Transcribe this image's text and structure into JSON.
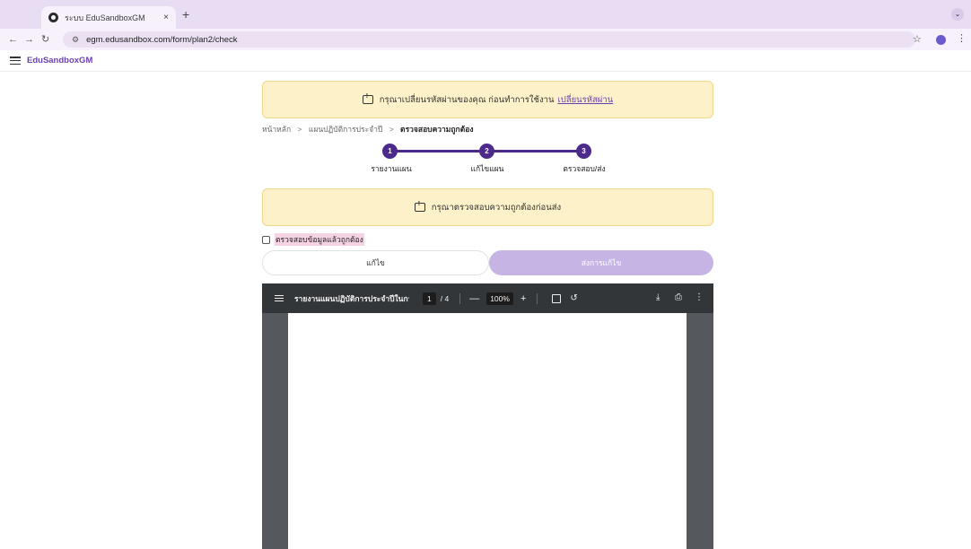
{
  "browser": {
    "tab_title": "ระบบ EduSandboxGM",
    "tab_close": "×",
    "new_tab": "+",
    "url": "egm.edusandbox.com/form/plan2/check"
  },
  "app": {
    "brand": "EduSandboxGM"
  },
  "notice_password": {
    "text": "กรุณาเปลี่ยนรหัสผ่านของคุณ ก่อนทำการใช้งาน",
    "link": "เปลี่ยนรหัสผ่าน"
  },
  "breadcrumb": {
    "items": [
      "หน้าหลัก",
      "แผนปฏิบัติการประจำปี",
      "ตรวจสอบความถูกต้อง"
    ],
    "separator": ">"
  },
  "stepper": {
    "steps": [
      {
        "number": "1",
        "label": "รายงานแผน"
      },
      {
        "number": "2",
        "label": "แก้ไขแผน"
      },
      {
        "number": "3",
        "label": "ตรวจสอบ/ส่ง"
      }
    ]
  },
  "notice_verify": {
    "text": "กรุณาตรวจสอบความถูกต้องก่อนส่ง"
  },
  "confirm": {
    "label": "ตรวจสอบข้อมูลแล้วถูกต้อง",
    "checked": false
  },
  "actions": {
    "edit_label": "แก้ไข",
    "submit_label": "ส่งการแก้ไข"
  },
  "pdf": {
    "title": "รายงานแผนปฏิบัติการประจำปีในการ...",
    "page": "1",
    "total": "/ 4",
    "zoom": "100%",
    "minus": "—",
    "plus": "+"
  },
  "colors": {
    "accent": "#4b2a8c",
    "notice_bg": "#fdf1c9",
    "submit_disabled": "#c6b4e4"
  }
}
